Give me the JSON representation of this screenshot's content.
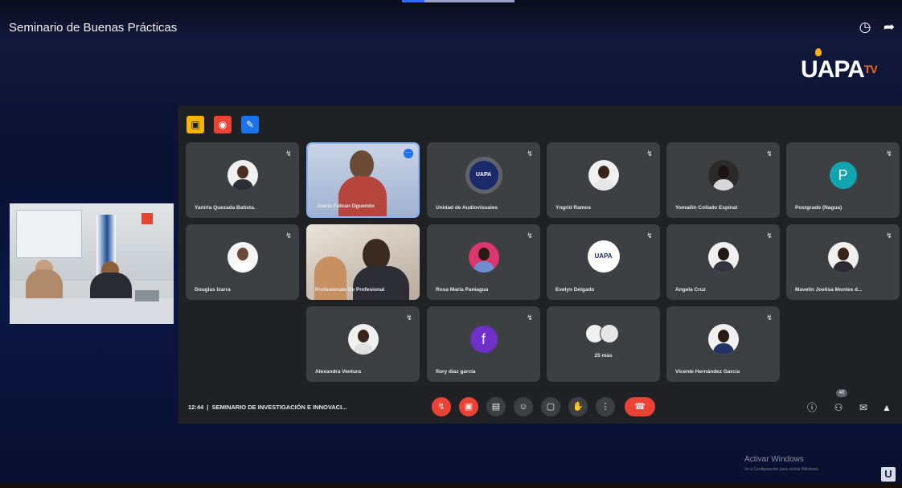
{
  "video": {
    "title": "Seminario de Buenas Prácticas",
    "brand_logo": "UAPA",
    "brand_suffix": "TV",
    "top_icons": [
      "clock-icon",
      "share-arrow-icon"
    ]
  },
  "meet": {
    "participants": [
      {
        "name": "Yanirla Quezada Batista.",
        "avatar": "photo"
      },
      {
        "name": "Joana Fabian Oguendo",
        "avatar": "video",
        "speaking": true
      },
      {
        "name": "Unidad de Audiovisuales",
        "avatar": "logo",
        "logo_text": "UAPA"
      },
      {
        "name": "Yngrid Ramos",
        "avatar": "photo"
      },
      {
        "name": "Yomailin Collado Espinal",
        "avatar": "photo"
      },
      {
        "name": "Postgrado (Nagua)",
        "avatar": "letter",
        "letter": "P",
        "color": "#12a4af"
      },
      {
        "name": "Douglas Izarra",
        "avatar": "photo"
      },
      {
        "name": "Profesionale De Profesional",
        "avatar": "video"
      },
      {
        "name": "Rosa Maria Paniagua",
        "avatar": "photo"
      },
      {
        "name": "Evelyn Delgado",
        "avatar": "logo",
        "logo_text": "UAPA"
      },
      {
        "name": "Angela Cruz",
        "avatar": "photo"
      },
      {
        "name": "Mavelin Joelisa Montes d...",
        "avatar": "photo"
      },
      {
        "name": "Alexandra Ventura",
        "avatar": "photo"
      },
      {
        "name": "flory diaz garcia",
        "avatar": "letter",
        "letter": "f",
        "color": "#6f2fc9"
      },
      {
        "name": "25 más",
        "avatar": "group"
      },
      {
        "name": "Vicente Hernández Garcia",
        "avatar": "photo"
      }
    ],
    "time": "12:44",
    "separator": "|",
    "meeting_title": "SEMINARIO DE INVESTIGACIÓN E INNOVACI...",
    "people_count": "40",
    "controls": {
      "mic": "mic-off-icon",
      "camera": "camera-off-icon",
      "captions": "captions-icon",
      "emoji": "emoji-icon",
      "present": "present-icon",
      "hand": "raise-hand-icon",
      "more": "more-vert-icon",
      "end": "end-call-icon"
    },
    "colors": {
      "accent_red": "#ea4335",
      "tile_bg": "#3c4043",
      "speaking": "#8ab4f8"
    }
  },
  "windows": {
    "activate_title": "Activar Windows",
    "activate_sub": "Ve a Configuración para activar Windows."
  }
}
